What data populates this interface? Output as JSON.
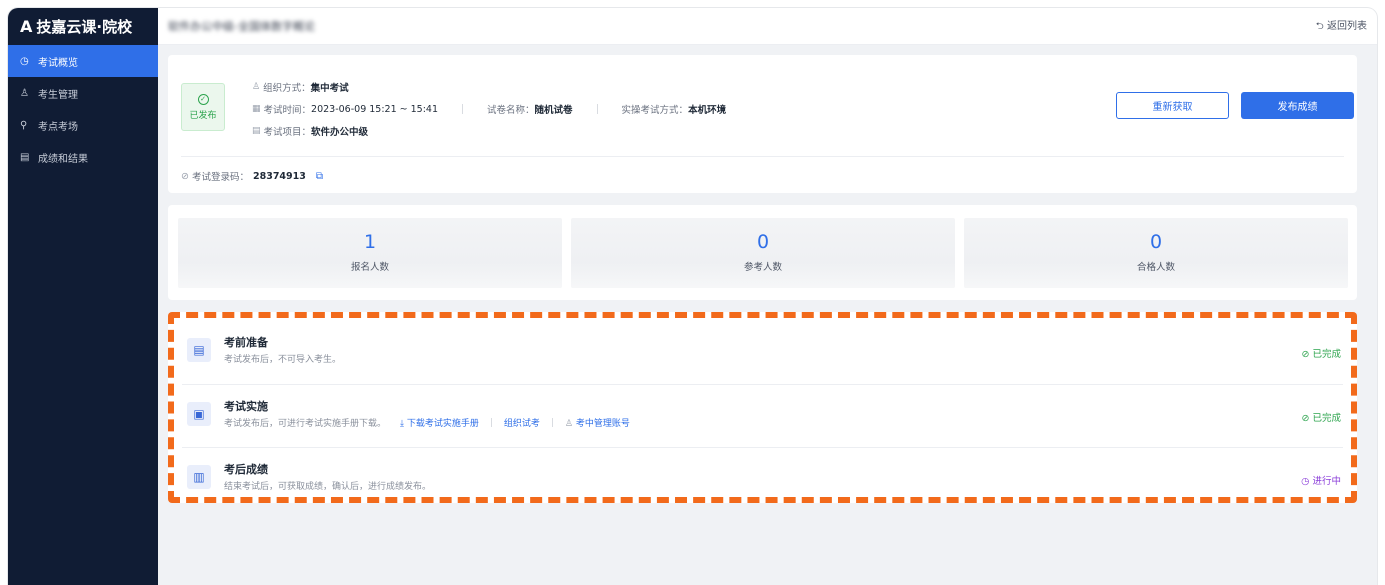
{
  "app": {
    "logo_mark": "A",
    "logo_text": "技嘉云课·院校"
  },
  "sidebar": {
    "items": [
      {
        "label": "考试概览",
        "icon": "clock-icon",
        "glyph": "◷",
        "active": true
      },
      {
        "label": "考生管理",
        "icon": "user-icon",
        "glyph": "♙",
        "active": false
      },
      {
        "label": "考点考场",
        "icon": "location-icon",
        "glyph": "⚲",
        "active": false
      },
      {
        "label": "成绩和结果",
        "icon": "table-icon",
        "glyph": "▤",
        "active": false
      }
    ]
  },
  "topbar": {
    "title": "软件办公中级-全国体数字概论",
    "back_label": "返回列表"
  },
  "exam": {
    "status": "已发布",
    "org_label": "组织方式：",
    "org_value": "集中考试",
    "time_label": "考试时间：",
    "time_value": "2023-06-09 15:21 ~ 15:41",
    "paper_label": "试卷名称：",
    "paper_value": "随机试卷",
    "mode_label": "实操考试方式：",
    "mode_value": "本机环境",
    "project_label": "考试项目：",
    "project_value": "软件办公中级",
    "refetch_label": "重新获取",
    "publish_label": "发布成绩",
    "login_label": "考试登录码：",
    "login_value": "28374913"
  },
  "stats": [
    {
      "value": "1",
      "label": "报名人数"
    },
    {
      "value": "0",
      "label": "参考人数"
    },
    {
      "value": "0",
      "label": "合格人数"
    }
  ],
  "steps": {
    "prep": {
      "title": "考前准备",
      "desc": "考试发布后，不可导入考生。",
      "status": "已完成"
    },
    "exec": {
      "title": "考试实施",
      "desc": "考试发布后，可进行考试实施手册下载。",
      "link_download": "下载考试实施手册",
      "link_organize": "组织试考",
      "link_accounts": "考中管理账号",
      "status": "已完成"
    },
    "result": {
      "title": "考后成绩",
      "desc": "结束考试后，可获取成绩，确认后，进行成绩发布。",
      "status": "进行中"
    }
  },
  "colors": {
    "primary": "#2f6fe8",
    "sidebar_bg": "#101c34",
    "success": "#2da44e",
    "in_progress": "#8b3fd9",
    "highlight_border": "#f26a1b"
  }
}
